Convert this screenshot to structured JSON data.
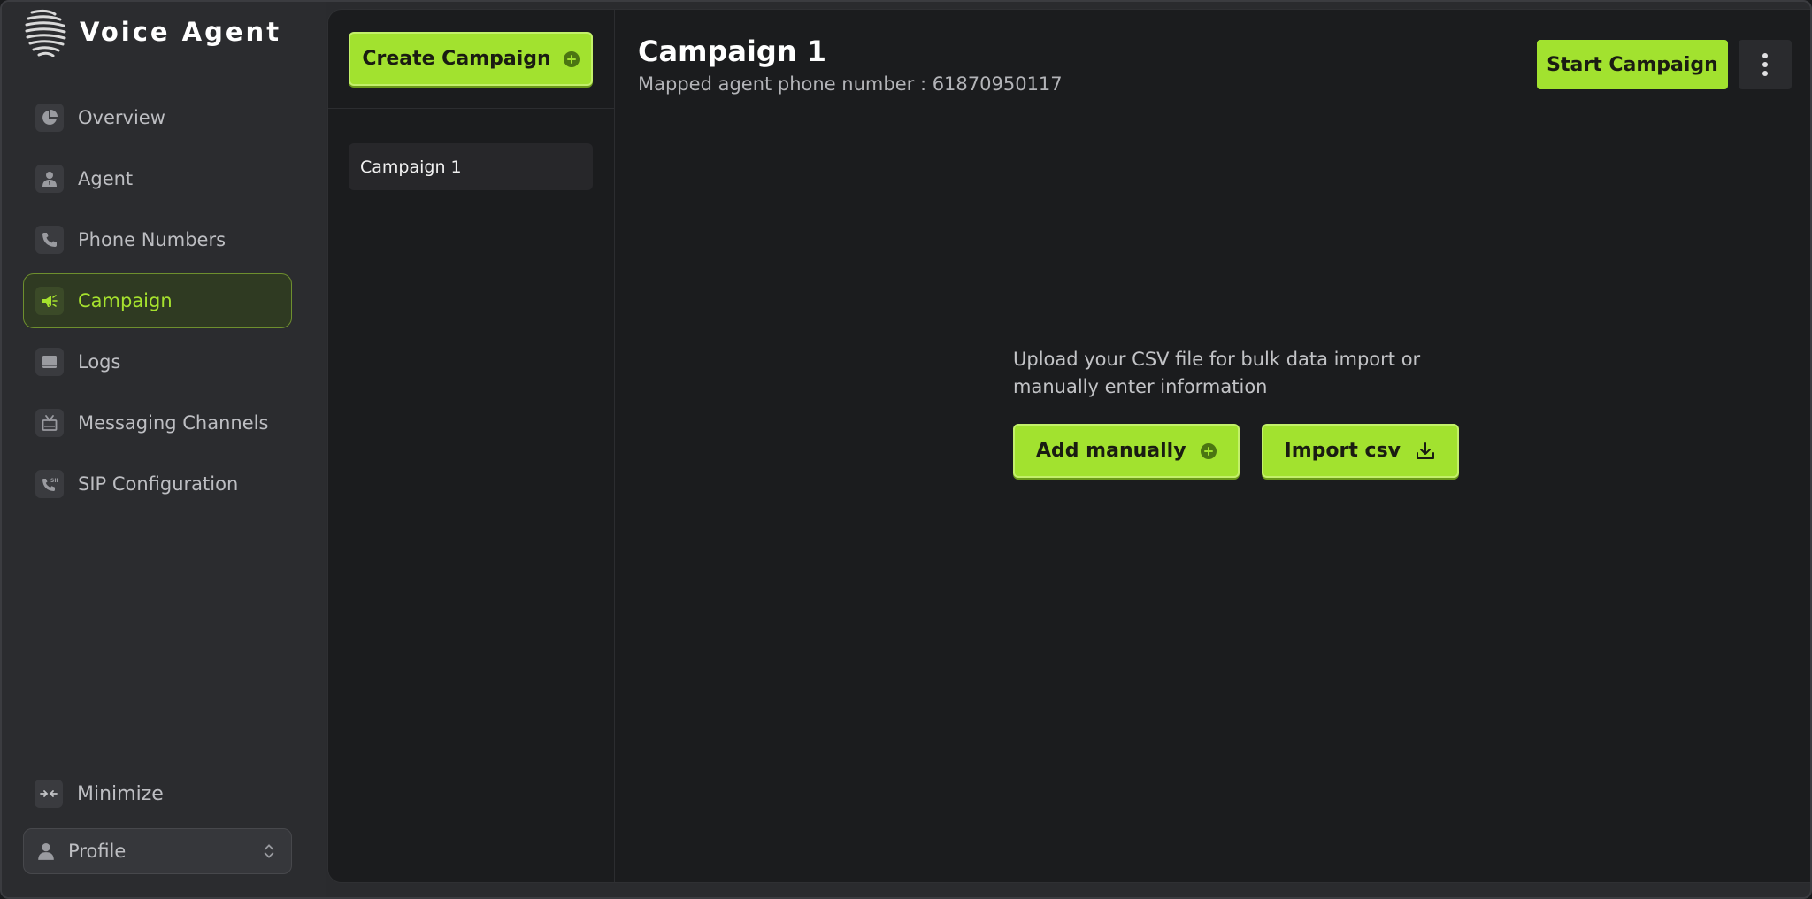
{
  "app": {
    "name": "Voice Agent"
  },
  "sidebar": {
    "items": [
      {
        "label": "Overview",
        "icon": "pie-chart-icon",
        "active": false
      },
      {
        "label": "Agent",
        "icon": "agent-icon",
        "active": false
      },
      {
        "label": "Phone Numbers",
        "icon": "phone-icon",
        "active": false
      },
      {
        "label": "Campaign",
        "icon": "megaphone-icon",
        "active": true
      },
      {
        "label": "Logs",
        "icon": "logs-icon",
        "active": false
      },
      {
        "label": "Messaging Channels",
        "icon": "tv-icon",
        "active": false
      },
      {
        "label": "SIP Configuration",
        "icon": "sip-phone-icon",
        "active": false
      }
    ],
    "minimize_label": "Minimize",
    "profile_label": "Profile"
  },
  "campaigns": {
    "create_label": "Create Campaign",
    "list": [
      {
        "name": "Campaign 1"
      }
    ]
  },
  "detail": {
    "title": "Campaign 1",
    "subtitle": "Mapped agent phone number : 61870950117",
    "start_label": "Start Campaign",
    "empty_message": "Upload your CSV file for bulk data import or manually enter information",
    "add_manually_label": "Add manually",
    "import_csv_label": "Import csv"
  },
  "colors": {
    "accent": "#a2e22f",
    "background": "#1b1c1e",
    "sidebar": "#2b2c2f"
  }
}
